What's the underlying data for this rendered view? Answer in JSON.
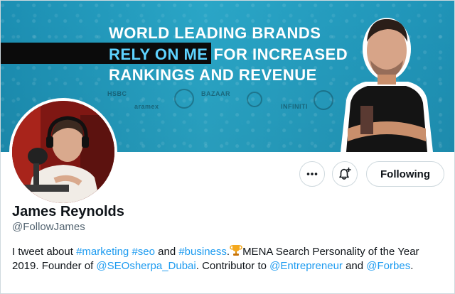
{
  "banner": {
    "line1": "WORLD LEADING BRANDS",
    "line2_highlight": "RELY ON ME",
    "line2_rest": "FOR INCREASED",
    "line3": "RANKINGS AND REVENUE",
    "logos": [
      "HSBC",
      "aramex",
      "BAZAAR",
      "INFINITI"
    ],
    "colors": {
      "background": "#1f96b9",
      "highlight": "#5ed3ff",
      "block": "#0b0b0b"
    }
  },
  "profile": {
    "name": "James Reynolds",
    "handle": "@FollowJames"
  },
  "actions": {
    "more_icon": "more-horizontal-icon",
    "notify_icon": "bell-plus-icon",
    "follow_label": "Following"
  },
  "bio": {
    "t1": "I tweet about ",
    "l1": "#marketing",
    "t2": " ",
    "l2": "#seo",
    "t3": " and ",
    "l3": "#business",
    "t4": ".",
    "emoji": "trophy-icon",
    "t5": "MENA Search Personality of the Year 2019. Founder of ",
    "l4": "@SEOsherpa_Dubai",
    "t6": ".  Contributor to ",
    "l5": "@Entrepreneur",
    "t7": " and ",
    "l6": "@Forbes",
    "t8": "."
  },
  "colors": {
    "link": "#1d9bf0",
    "text": "#0f1419",
    "muted": "#536471"
  }
}
